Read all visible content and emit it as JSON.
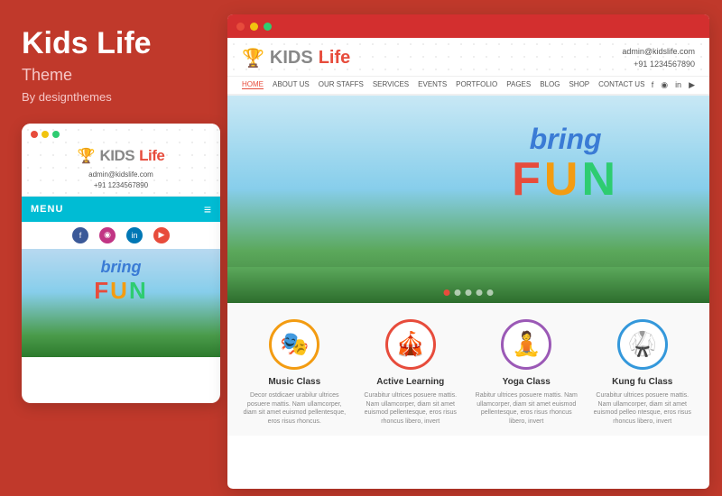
{
  "left": {
    "title": "Kids Life",
    "subtitle": "Theme",
    "by_text": "By designthemes"
  },
  "mobile": {
    "logo_kids": "KIDS",
    "logo_life": "Life",
    "email": "admin@kidslife.com",
    "phone": "+91 1234567890",
    "menu_text": "MENU",
    "bring_text": "bring",
    "fun_text": "FUN"
  },
  "desktop": {
    "logo_kids": "KIDS",
    "logo_life": "Life",
    "email": "admin@kidslife.com",
    "phone": "+91 1234567890",
    "nav_links": [
      "HOME",
      "ABOUT US",
      "OUR STAFFS",
      "SERVICES",
      "EVENTS",
      "PORTFOLIO",
      "PAGES",
      "BLOG",
      "SHOP",
      "CONTACT US"
    ],
    "hero_bring": "bring",
    "hero_fun": "FUN",
    "services": [
      {
        "name": "Music Class",
        "emoji": "🎭",
        "desc": "Decor ostdicaer urabilur ultrices posuere mattis. Nam ullamcorper, diam sit amet euismod pellentesque, eros risus rhoncus."
      },
      {
        "name": "Active Learning",
        "emoji": "🎪",
        "desc": "Curabitur ultrices posuere mattis. Nam ullamcorper, diam sit amet euismod pellentesque, eros risus rhoncus libero, invert"
      },
      {
        "name": "Yoga Class",
        "emoji": "🧘",
        "desc": "Rabitur ultrices posuere mattis. Nam ullamcorper, diam sit amet euismod pellentesque, eros risus rhoncus libero, invert"
      },
      {
        "name": "Kung fu Class",
        "emoji": "🥋",
        "desc": "Curabitur ultrices posuere mattis. Nam ullamcorper, diam sit amet euismod pelleo ntesque, eros risus rhoncus libero, invert"
      }
    ]
  },
  "dots": {
    "colors": {
      "red": "#e74c3c",
      "yellow": "#f1c40f",
      "green": "#2ecc71"
    }
  }
}
